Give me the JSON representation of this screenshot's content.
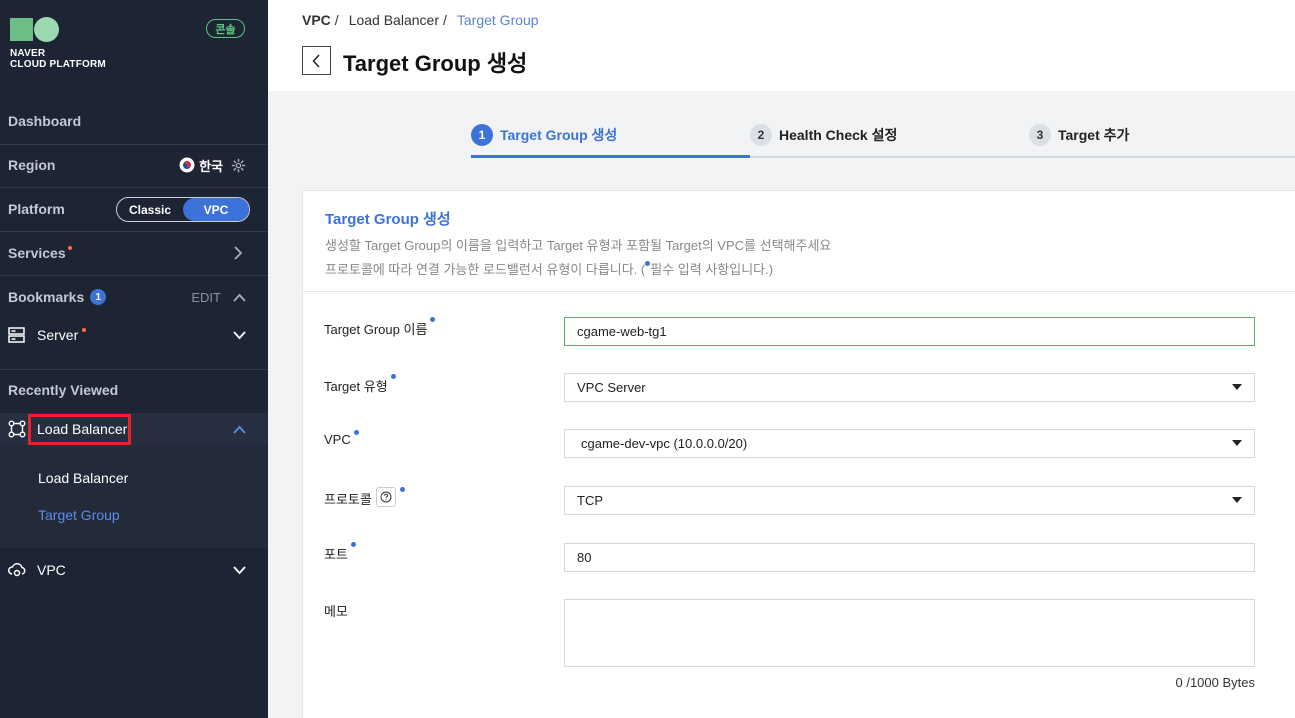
{
  "sidebar": {
    "logo_line1": "NAVER",
    "logo_line2": "CLOUD PLATFORM",
    "console_label": "콘솔",
    "dashboard": "Dashboard",
    "region_label": "Region",
    "region_value": "한국",
    "platform_label": "Platform",
    "platform_options": [
      "Classic",
      "VPC"
    ],
    "platform_selected": "VPC",
    "services_label": "Services",
    "bookmarks_label": "Bookmarks",
    "bookmarks_count": "1",
    "bookmarks_edit": "EDIT",
    "bookmark_items": [
      "Server"
    ],
    "recently_viewed_label": "Recently Viewed",
    "recent_items": [
      {
        "label": "Load Balancer",
        "expanded": true,
        "children": [
          "Load Balancer",
          "Target Group"
        ],
        "active_child": "Target Group"
      },
      {
        "label": "VPC",
        "expanded": false
      }
    ],
    "colors": {
      "background": "#1d2433",
      "accent": "#3d73d8",
      "badge_green": "#5cc57f",
      "highlight_red": "#e8222d"
    }
  },
  "breadcrumb": [
    "VPC",
    "Load Balancer",
    "Target Group"
  ],
  "page_title": "Target Group 생성",
  "steps": [
    {
      "num": "1",
      "label": "Target Group 생성",
      "active": true
    },
    {
      "num": "2",
      "label": "Health Check 설정",
      "active": false
    },
    {
      "num": "3",
      "label": "Target 추가",
      "active": false
    }
  ],
  "panel": {
    "title": "Target Group 생성",
    "desc_line1": "생성할 Target Group의 이름을 입력하고 Target 유형과 포함될 Target의 VPC를 선택해주세요",
    "desc_line2_a": "프로토콜에 따라 연결 가능한 로드밸런서 유형이 다릅니다. (",
    "desc_line2_b": "필수 입력 사항입니다.)"
  },
  "form": {
    "name_label": "Target Group 이름",
    "name_value": "cgame-web-tg1",
    "type_label": "Target 유형",
    "type_value": "VPC Server",
    "vpc_label": "VPC",
    "vpc_value": "cgame-dev-vpc (10.0.0.0/20)",
    "protocol_label": "프로토콜",
    "protocol_value": "TCP",
    "port_label": "포트",
    "port_value": "80",
    "memo_label": "메모",
    "memo_value": "",
    "memo_counter": "0 /1000 Bytes"
  }
}
